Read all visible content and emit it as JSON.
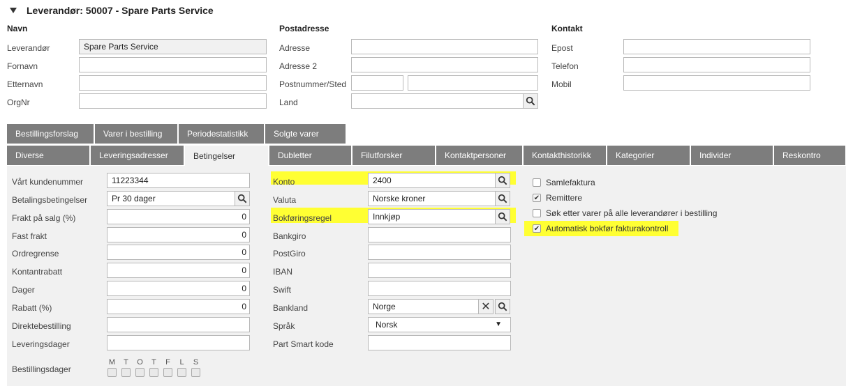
{
  "header": {
    "title": "Leverandør: 50007 - Spare Parts Service"
  },
  "sections": {
    "navn": "Navn",
    "postadresse": "Postadresse",
    "kontakt": "Kontakt"
  },
  "navn": {
    "leverandor_label": "Leverandør",
    "leverandor_value": "Spare Parts Service",
    "fornavn_label": "Fornavn",
    "etternavn_label": "Etternavn",
    "orgnr_label": "OrgNr"
  },
  "post": {
    "adresse_label": "Adresse",
    "adresse2_label": "Adresse 2",
    "postnr_label": "Postnummer/Sted",
    "land_label": "Land"
  },
  "kontakt": {
    "epost_label": "Epost",
    "telefon_label": "Telefon",
    "mobil_label": "Mobil"
  },
  "tabs_top": [
    "Bestillingsforslag",
    "Varer i bestilling",
    "Periodestatistikk",
    "Solgte varer"
  ],
  "tabs_bottom": [
    "Diverse",
    "Leveringsadresser",
    "Betingelser",
    "Dubletter",
    "Filutforsker",
    "Kontaktpersoner",
    "Kontakthistorikk",
    "Kategorier",
    "Individer",
    "Reskontro"
  ],
  "left": {
    "kundenummer_label": "Vårt kundenummer",
    "kundenummer_value": "11223344",
    "betaling_label": "Betalingsbetingelser",
    "betaling_value": "Pr 30 dager",
    "frakt_label": "Frakt på salg (%)",
    "frakt_value": "0",
    "fastfrakt_label": "Fast frakt",
    "fastfrakt_value": "0",
    "ordregrense_label": "Ordregrense",
    "ordregrense_value": "0",
    "kontantrabatt_label": "Kontantrabatt",
    "kontantrabatt_value": "0",
    "dager_label": "Dager",
    "dager_value": "0",
    "rabatt_label": "Rabatt (%)",
    "rabatt_value": "0",
    "direkte_label": "Direktebestilling",
    "leveringsdager_label": "Leveringsdager",
    "bestillingsdager_label": "Bestillingsdager",
    "days": [
      "M",
      "T",
      "O",
      "T",
      "F",
      "L",
      "S"
    ]
  },
  "middle": {
    "konto_label": "Konto",
    "konto_value": "2400",
    "valuta_label": "Valuta",
    "valuta_value": "Norske kroner",
    "bokf_label": "Bokføringsregel",
    "bokf_value": "Innkjøp",
    "bankgiro_label": "Bankgiro",
    "postgiro_label": "PostGiro",
    "iban_label": "IBAN",
    "swift_label": "Swift",
    "bankland_label": "Bankland",
    "bankland_value": "Norge",
    "sprak_label": "Språk",
    "sprak_value": "Norsk",
    "partsmart_label": "Part Smart kode"
  },
  "right": {
    "samlefaktura": "Samlefaktura",
    "remittere": "Remittere",
    "sok": "Søk etter varer på alle leverandører i bestilling",
    "automatisk": "Automatisk bokfør fakturakontroll"
  },
  "colors": {
    "tab_bg": "#7d7d7d",
    "highlight": "#ffff33",
    "panel_bg": "#f1f1f1"
  }
}
